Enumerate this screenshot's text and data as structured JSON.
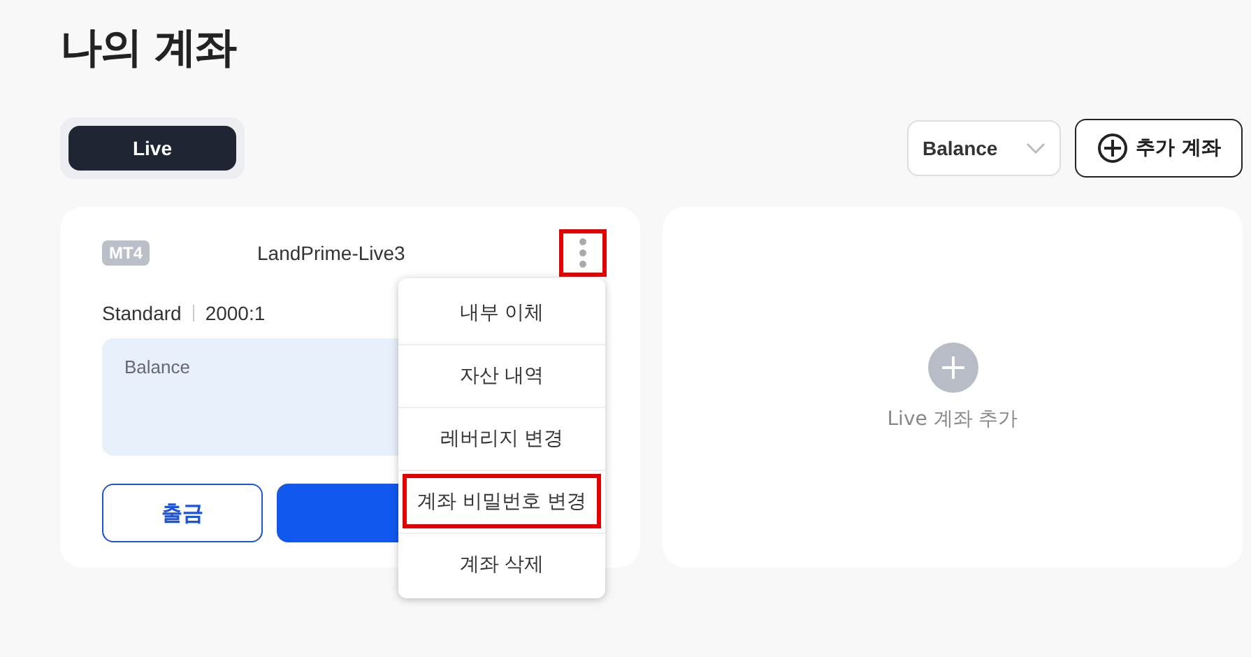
{
  "page_title": "나의 계좌",
  "tabs": [
    {
      "label": "Live",
      "selected": true
    }
  ],
  "sort_select": {
    "value": "Balance"
  },
  "add_account_button": {
    "label": "추가 계좌"
  },
  "account_card": {
    "platform": "MT4",
    "server": "LandPrime-Live3",
    "account_type": "Standard",
    "leverage": "2000:1",
    "balance_label": "Balance",
    "withdraw_button": "출금",
    "more_button_highlighted": true
  },
  "context_menu": [
    {
      "label": "내부 이체",
      "highlighted": false
    },
    {
      "label": "자산 내역",
      "highlighted": false
    },
    {
      "label": "레버리지 변경",
      "highlighted": false
    },
    {
      "label": "계좌 비밀번호 변경",
      "highlighted": true
    },
    {
      "label": "계좌 삭제",
      "highlighted": false
    }
  ],
  "add_live_card": {
    "label": "Live 계좌 추가"
  }
}
